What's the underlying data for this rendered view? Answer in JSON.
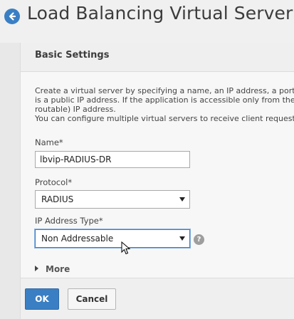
{
  "header": {
    "title": "Load Balancing Virtual Server",
    "back_icon": "arrow-left-circle-icon",
    "accent_color": "#3a7fc4"
  },
  "panel": {
    "title": "Basic Settings",
    "description_lines": [
      "Create a virtual server by specifying a name, an IP address, a port, ar",
      "is a public IP address. If the application is accessible only from the lo",
      "routable) IP address.",
      "You can configure multiple virtual servers to receive client requests,"
    ],
    "name_label": "Name*",
    "name_value": "lbvip-RADIUS-DR",
    "protocol_label": "Protocol*",
    "protocol_value": "RADIUS",
    "ip_type_label": "IP Address Type*",
    "ip_type_value": "Non Addressable",
    "help_icon_glyph": "?",
    "more_label": "More"
  },
  "footer": {
    "ok_label": "OK",
    "cancel_label": "Cancel"
  }
}
